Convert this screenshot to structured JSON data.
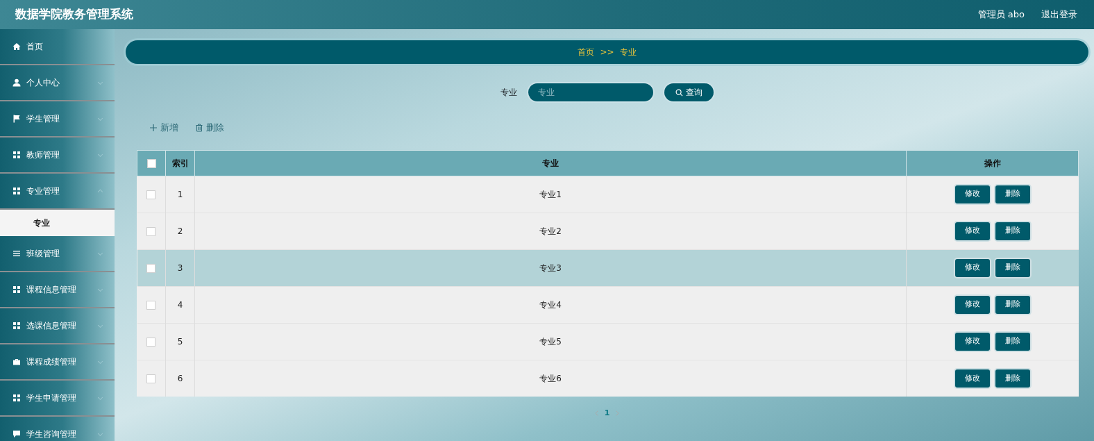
{
  "header": {
    "title": "数据学院教务管理系统",
    "user": "管理员 abo",
    "logout": "退出登录"
  },
  "sidebar": {
    "items": [
      {
        "label": "首页",
        "has_children": false
      },
      {
        "label": "个人中心",
        "has_children": true,
        "expanded": false
      },
      {
        "label": "学生管理",
        "has_children": true,
        "expanded": false
      },
      {
        "label": "教师管理",
        "has_children": true,
        "expanded": false
      },
      {
        "label": "专业管理",
        "has_children": true,
        "expanded": true,
        "children": [
          {
            "label": "专业",
            "selected": true
          }
        ]
      },
      {
        "label": "班级管理",
        "has_children": true,
        "expanded": false
      },
      {
        "label": "课程信息管理",
        "has_children": true,
        "expanded": false
      },
      {
        "label": "选课信息管理",
        "has_children": true,
        "expanded": false
      },
      {
        "label": "课程成绩管理",
        "has_children": true,
        "expanded": false
      },
      {
        "label": "学生申请管理",
        "has_children": true,
        "expanded": false
      },
      {
        "label": "学生咨询管理",
        "has_children": true,
        "expanded": false
      }
    ]
  },
  "breadcrumb": [
    "首页",
    ">>",
    "专业"
  ],
  "search": {
    "label": "专业",
    "placeholder": "专业",
    "button": "查询"
  },
  "actions": [
    "新增",
    "删除"
  ],
  "table": {
    "columns": [
      "索引",
      "专业",
      "操作"
    ],
    "header_checked": false,
    "rows": [
      {
        "index": "1",
        "major": "专业1",
        "checked": false,
        "selected": false,
        "buttons": [
          "修改",
          "删除"
        ]
      },
      {
        "index": "2",
        "major": "专业2",
        "checked": false,
        "selected": false,
        "buttons": [
          "修改",
          "删除"
        ]
      },
      {
        "index": "3",
        "major": "专业3",
        "checked": false,
        "selected": true,
        "buttons": [
          "修改",
          "删除"
        ]
      },
      {
        "index": "4",
        "major": "专业4",
        "checked": false,
        "selected": false,
        "buttons": [
          "修改",
          "删除"
        ]
      },
      {
        "index": "5",
        "major": "专业5",
        "checked": false,
        "selected": false,
        "buttons": [
          "修改",
          "删除"
        ]
      },
      {
        "index": "6",
        "major": "专业6",
        "checked": false,
        "selected": false,
        "buttons": [
          "修改",
          "删除"
        ]
      }
    ]
  },
  "pagination": {
    "pages": [
      {
        "label": "1",
        "selected": true
      }
    ]
  }
}
